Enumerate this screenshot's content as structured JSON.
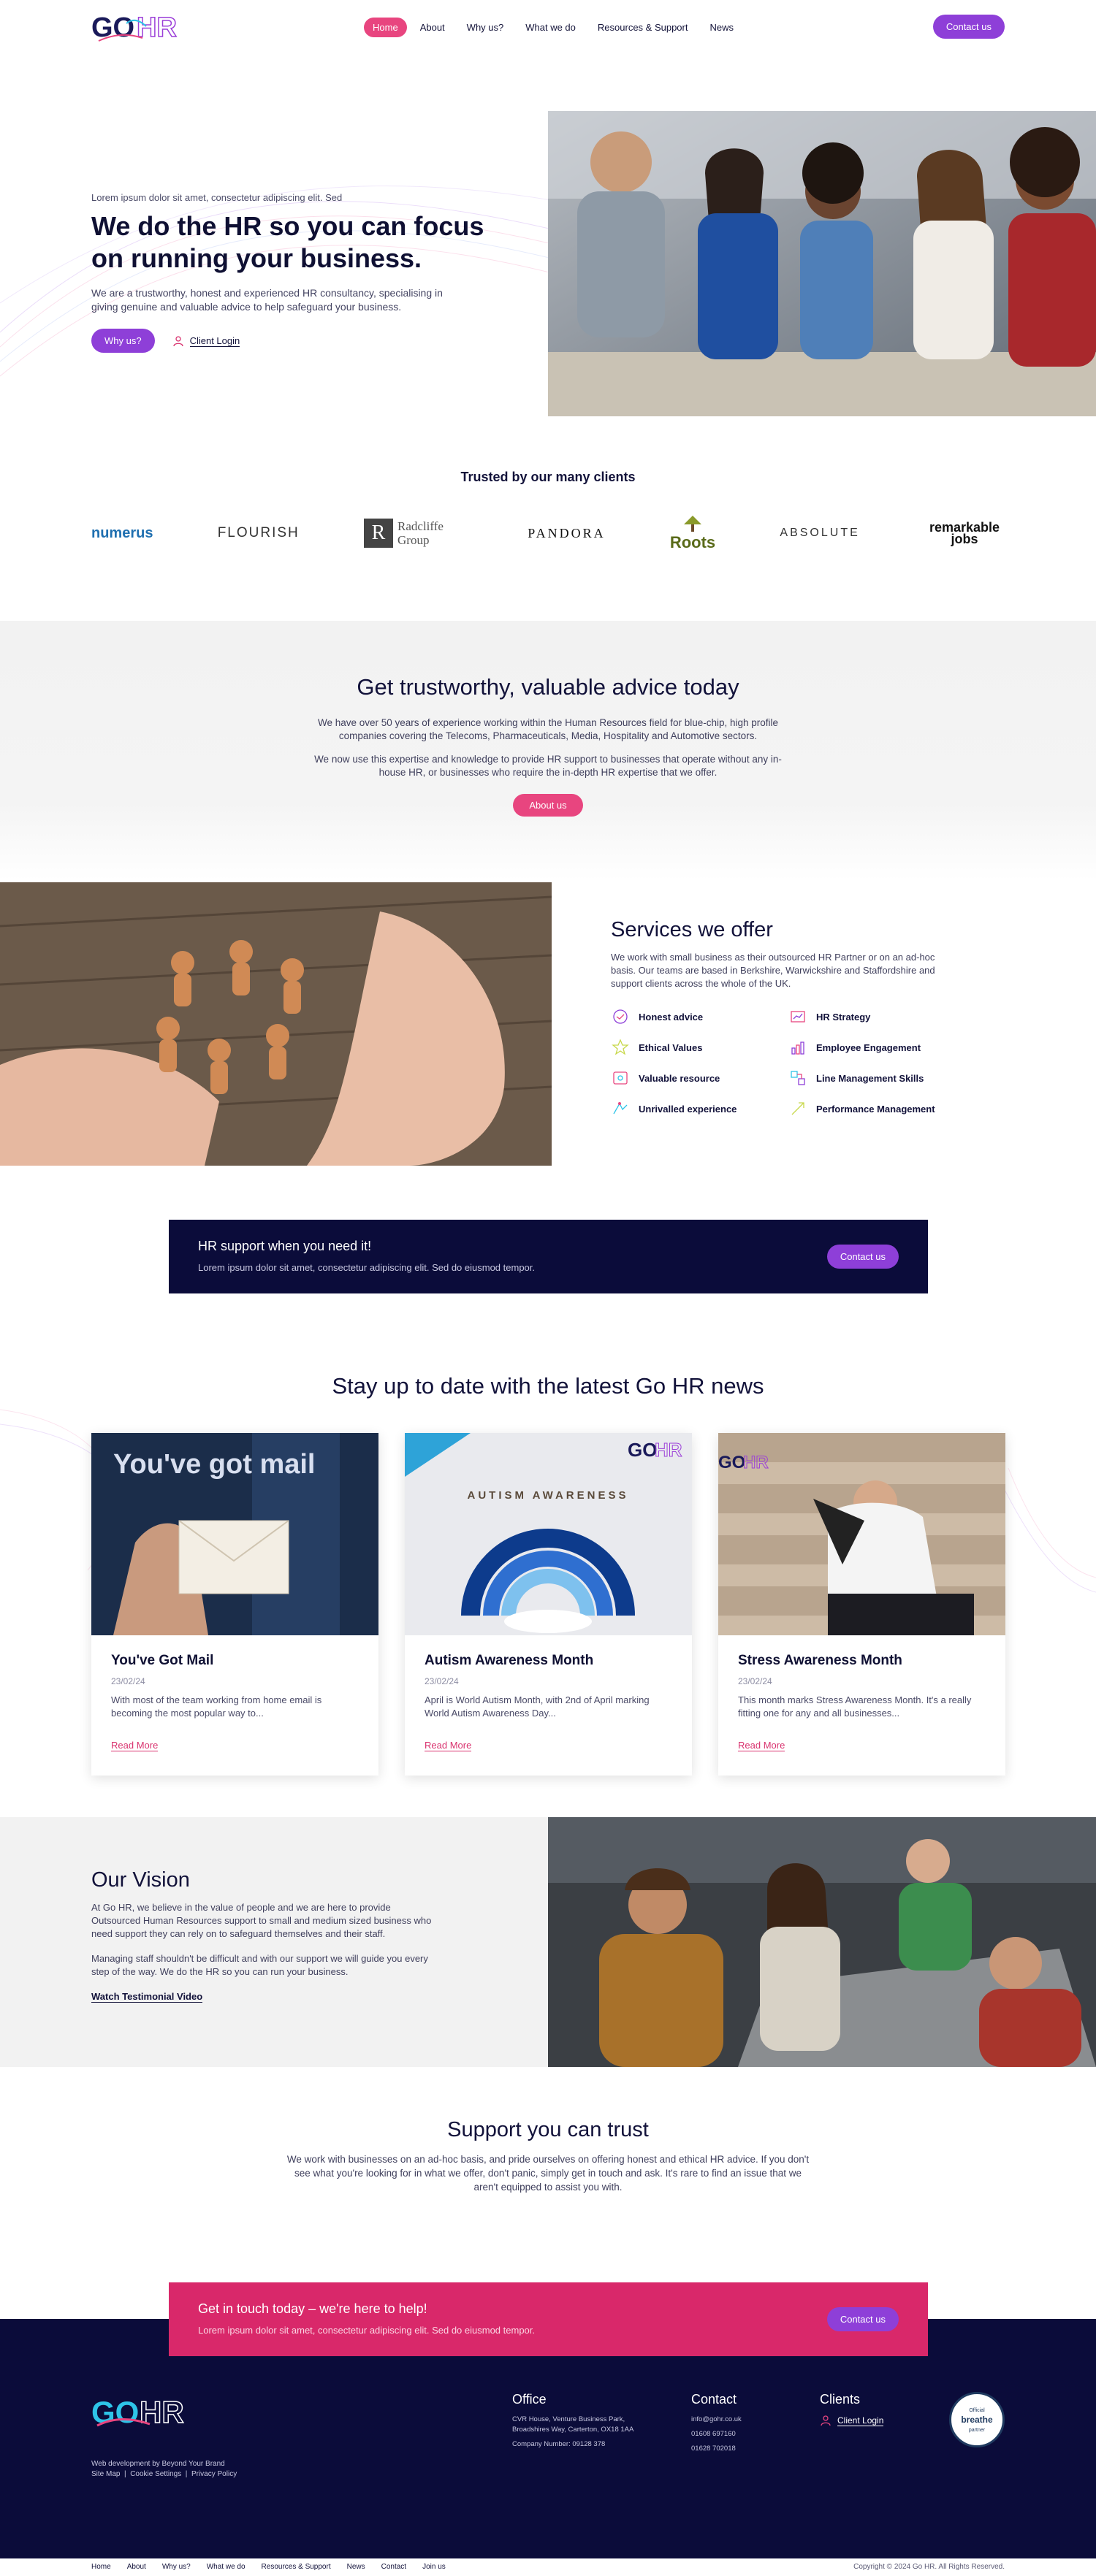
{
  "nav": {
    "items": [
      "Home",
      "About",
      "Why us?",
      "What we do",
      "Resources & Support",
      "News"
    ],
    "contact_label": "Contact us"
  },
  "hero": {
    "eyebrow": "Lorem ipsum dolor sit amet, consectetur adipiscing elit. Sed",
    "title": "We do the HR so you can focus on running your business.",
    "description": "We are a trustworthy, honest and experienced HR consultancy, specialising in giving genuine and valuable advice to help safeguard your business.",
    "why_us_label": "Why us?",
    "client_login_label": "Client Login"
  },
  "trusted": {
    "title": "Trusted by our many clients",
    "logos": [
      "numerus",
      "FLOURISH",
      "Radcliffe Group",
      "PANDORA",
      "Roots",
      "ABSOLUTE",
      "remarkable jobs"
    ]
  },
  "advice": {
    "title": "Get trustworthy, valuable advice today",
    "paragraph1": "We have over 50 years of experience working within the Human Resources field for blue-chip, high profile companies covering the Telecoms, Pharmaceuticals, Media, Hospitality and Automotive sectors.",
    "paragraph2": "We now use this expertise and knowledge to provide HR support to businesses that operate without any in-house HR, or businesses who require the in-depth HR expertise that we offer.",
    "button_label": "About us"
  },
  "services": {
    "title": "Services we offer",
    "description": "We work with small business as their outsourced HR Partner or on an ad-hoc basis. Our teams are based in Berkshire, Warwickshire and Staffordshire and support clients across the whole of the UK.",
    "items": [
      "Honest advice",
      "HR Strategy",
      "Ethical Values",
      "Employee Engagement",
      "Valuable resource",
      "Line Management Skills",
      "Unrivalled experience",
      "Performance Management"
    ]
  },
  "cta": {
    "title": "HR support when you need it!",
    "subtitle": "Lorem ipsum dolor sit amet, consectetur adipiscing elit. Sed do eiusmod tempor.",
    "button_label": "Contact us"
  },
  "news": {
    "title": "Stay up to date with the latest Go HR news",
    "read_more": "Read More",
    "image_texts": {
      "mail": "You've got mail",
      "autism": "AUTISM AWARENESS"
    },
    "cards": [
      {
        "title": "You've Got Mail",
        "date": "23/02/24",
        "excerpt": "With most of the team working from home email is becoming the most popular way to..."
      },
      {
        "title": "Autism Awareness Month",
        "date": "23/02/24",
        "excerpt": "April is World Autism Month, with 2nd of April marking World Autism Awareness Day..."
      },
      {
        "title": "Stress Awareness Month",
        "date": "23/02/24",
        "excerpt": "This month marks Stress Awareness Month. It's a really fitting one for any and all businesses..."
      }
    ]
  },
  "vision": {
    "title": "Our Vision",
    "paragraph1": "At Go HR, we believe in the value of people and we are here to provide Outsourced Human Resources support to small and medium sized business who need support they can rely on to safeguard themselves and their staff.",
    "paragraph2": "Managing staff shouldn't be difficult and with our support we will guide you every step of the way. We do the HR so you can run your business.",
    "link_label": "Watch Testimonial Video"
  },
  "trust": {
    "title": "Support you can trust",
    "description": "We work with businesses on an ad-hoc basis, and pride ourselves on offering honest and ethical HR advice. If you don't see what you're looking for in what we offer, don't panic, simply get in touch and ask. It's rare to find an issue that we aren't equipped to assist you with."
  },
  "footer_cta": {
    "title": "Get in touch today – we're here to help!",
    "subtitle": "Lorem ipsum dolor sit amet, consectetur adipiscing elit. Sed do eiusmod tempor.",
    "button_label": "Contact us"
  },
  "footer": {
    "credit": "Web development by Beyond Your Brand",
    "small_links": [
      "Site Map",
      "Cookie Settings",
      "Privacy Policy"
    ],
    "office": {
      "title": "Office",
      "address1": "CVR House, Venture Business Park,",
      "address2": "Broadshires Way, Carterton, OX18 1AA",
      "company": "Company Number: 09128 378"
    },
    "contact": {
      "title": "Contact",
      "email": "info@gohr.co.uk",
      "phone1": "01608 697160",
      "phone2": "01628 702018"
    },
    "clients": {
      "title": "Clients",
      "login_label": "Client Login"
    },
    "badge": {
      "line1": "Official",
      "line2": "breathe",
      "line3": "partner"
    },
    "bottom_links": [
      "Home",
      "About",
      "Why us?",
      "What we do",
      "Resources & Support",
      "News",
      "Contact",
      "Join us"
    ],
    "copyright": "Copyright © 2024 Go HR. All Rights Reserved."
  },
  "colors": {
    "navy": "#0b0c3a",
    "pink": "#e8457f",
    "purple": "#8e3fd8",
    "footer_pink": "#d9286a"
  }
}
